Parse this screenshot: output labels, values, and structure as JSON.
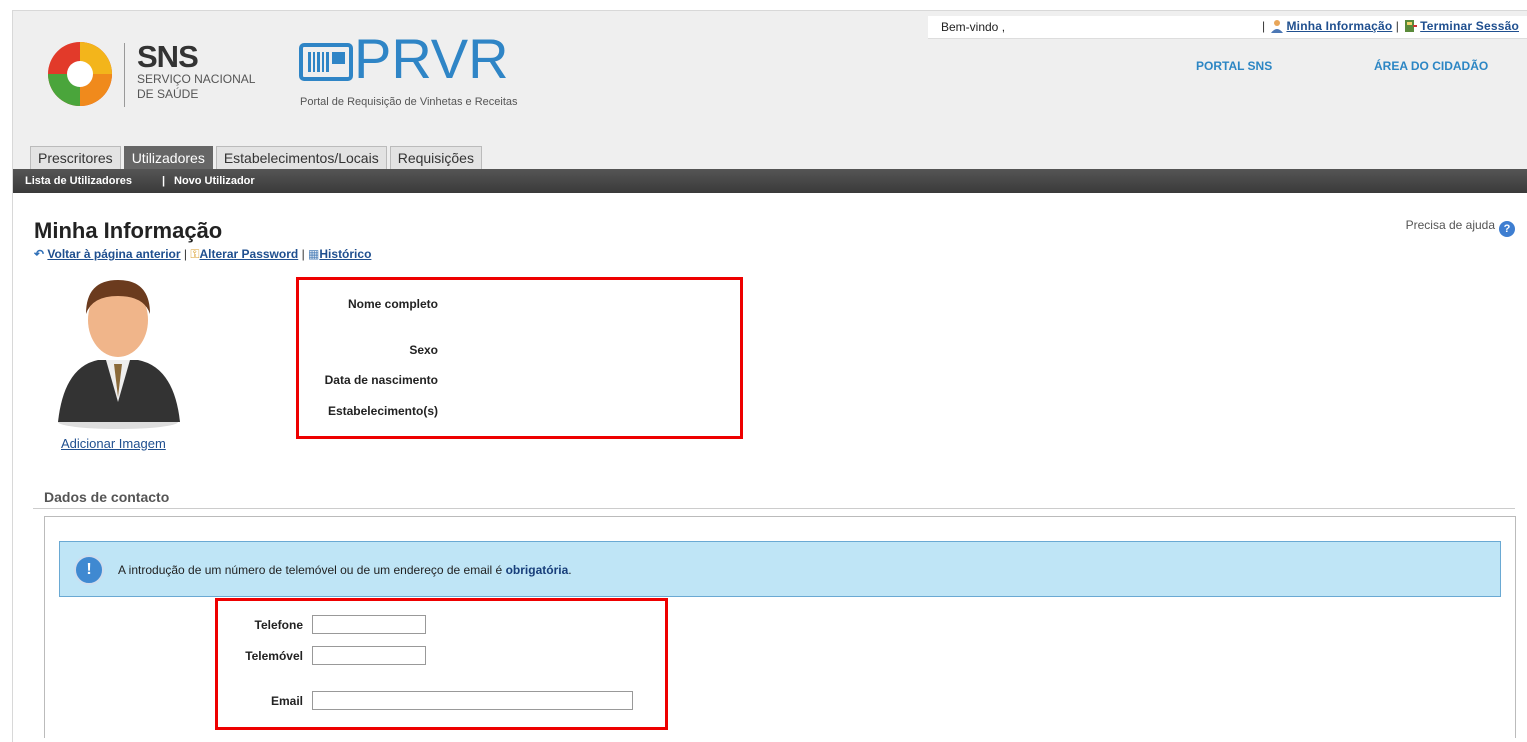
{
  "header": {
    "welcome": "Bem-vindo ,",
    "separator": "|",
    "minha_informacao": "Minha Informação",
    "terminar_sessao": "Terminar Sessão",
    "portal_sns": "PORTAL SNS",
    "area_cidadao": "ÁREA DO CIDADÃO"
  },
  "logo": {
    "sns": "SNS",
    "sns_line1": "SERVIÇO NACIONAL",
    "sns_line2": "DE SAÚDE",
    "prvr": "PRVR",
    "prvr_subtitle": "Portal de Requisição de Vinhetas e Receitas"
  },
  "tabs": [
    {
      "label": "Prescritores"
    },
    {
      "label": "Utilizadores"
    },
    {
      "label": "Estabelecimentos/Locais"
    },
    {
      "label": "Requisições"
    }
  ],
  "subnav": {
    "lista": "Lista de Utilizadores",
    "separator": "|",
    "novo": "Novo Utilizador"
  },
  "page": {
    "title": "Minha Informação",
    "help": "Precisa de ajuda",
    "back": "Voltar à página anterior",
    "sep": "|",
    "change_password": "Alterar Password",
    "history": "Histórico",
    "add_image": "Adicionar Imagem"
  },
  "info": {
    "nome": "Nome completo",
    "sexo": "Sexo",
    "data": "Data de nascimento",
    "estab": "Estabelecimento(s)"
  },
  "contact": {
    "section_title": "Dados de contacto",
    "alert_text": "A introdução de um número de telemóvel ou de um endereço de email é ",
    "alert_bold": "obrigatória",
    "alert_end": ".",
    "telefone": "Telefone",
    "telemovel": "Telemóvel",
    "email": "Email"
  },
  "colors": {
    "accent": "#2f85c6",
    "highlight": "#ee0000"
  }
}
